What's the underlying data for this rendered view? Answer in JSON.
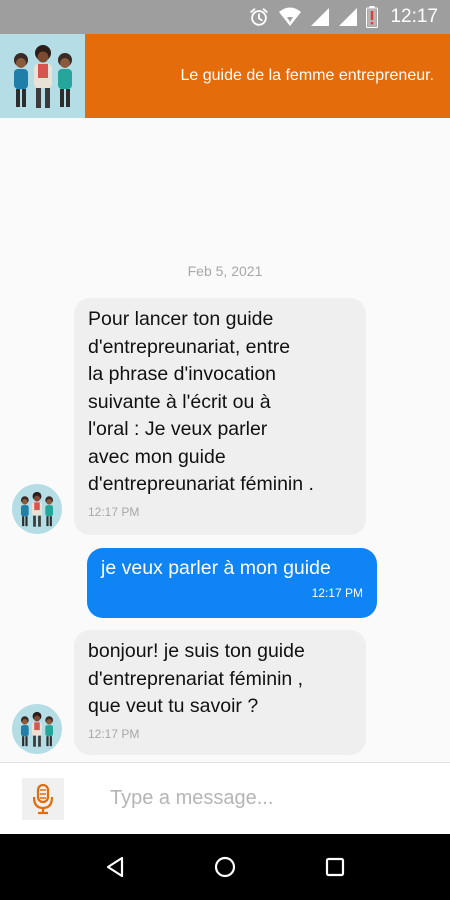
{
  "status_bar": {
    "time": "12:17",
    "icons": [
      "alarm-icon",
      "wifi-icon",
      "signal-icon",
      "signal-icon",
      "battery-alert-icon"
    ]
  },
  "header": {
    "title": "Le guide de la femme entrepreneur.",
    "avatar_icon": "group-of-women-icon"
  },
  "chat": {
    "date": "Feb 5, 2021",
    "messages": [
      {
        "direction": "in",
        "text": "Pour lancer ton guide\nd'entrepreunariat, entre\nla phrase d'invocation\nsuivante à l'écrit ou à\nl'oral : Je veux parler\navec mon guide\nd'entrepreunariat féminin .",
        "time": "12:17 PM"
      },
      {
        "direction": "out",
        "text": "je veux parler à mon guide",
        "time": "12:17 PM"
      },
      {
        "direction": "in",
        "text": "bonjour! je suis ton guide\nd'entreprenariat féminin ,\nque veut tu savoir ?",
        "time": "12:17 PM"
      }
    ]
  },
  "composer": {
    "placeholder": "Type a message...",
    "mic_icon": "microphone-icon"
  },
  "nav_bar": {
    "buttons": [
      "back-icon",
      "home-icon",
      "recents-icon"
    ]
  },
  "colors": {
    "header": "#e46c0a",
    "outgoing_bubble": "#0f84f4",
    "incoming_bubble": "#efefef",
    "status_bar": "#9e9e9e",
    "avatar_bg": "#b5dde6"
  }
}
